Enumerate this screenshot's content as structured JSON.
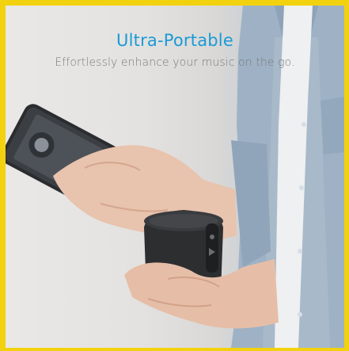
{
  "banner": {
    "headline": "Ultra-Portable",
    "subheadline": "Effortlessly enhance your music on the go."
  },
  "colors": {
    "border": "#f2d20f",
    "headline": "#1a9ad6",
    "subheadline": "#7a7a7a"
  },
  "image": {
    "depicts": [
      "person-in-denim-shirt",
      "smartphone",
      "portable-bluetooth-speaker"
    ]
  }
}
